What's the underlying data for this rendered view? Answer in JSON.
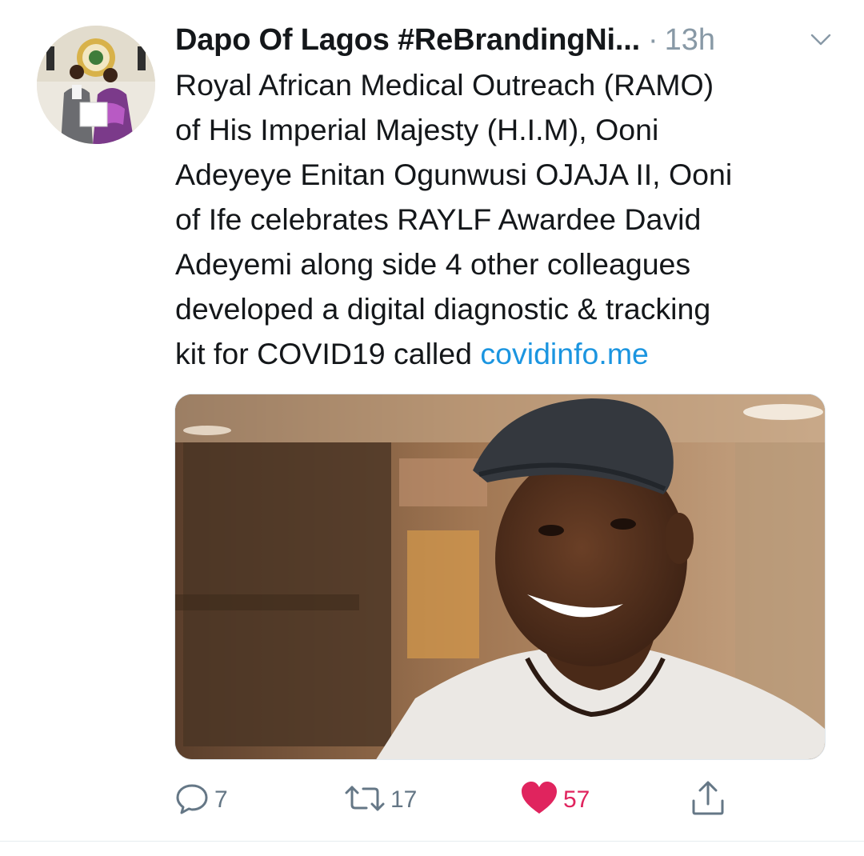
{
  "tweet": {
    "display_name": "Dapo Of Lagos #ReBrandingNi...",
    "separator": "·",
    "time": "13h",
    "text_lines": [
      "Royal African Medical Outreach (RAMO)",
      "of His Imperial Majesty (H.I.M), Ooni",
      "Adeyeye Enitan Ogunwusi OJAJA II, Ooni",
      "of Ife celebrates RAYLF Awardee David",
      "Adeyemi along side 4 other colleagues",
      "developed a digital diagnostic & tracking"
    ],
    "text_last_line_prefix": "kit for COVID19 called ",
    "link_text": "covidinfo.me"
  },
  "actions": {
    "reply_count": "7",
    "retweet_count": "17",
    "like_count": "57",
    "liked": true
  },
  "icons": {
    "reply": "reply-icon",
    "retweet": "retweet-icon",
    "like": "heart-icon",
    "share": "share-icon",
    "menu": "chevron-down-icon"
  },
  "colors": {
    "link": "#1b95e0",
    "like": "#e0245e",
    "muted": "#8899a6",
    "action_gray": "#657786"
  }
}
